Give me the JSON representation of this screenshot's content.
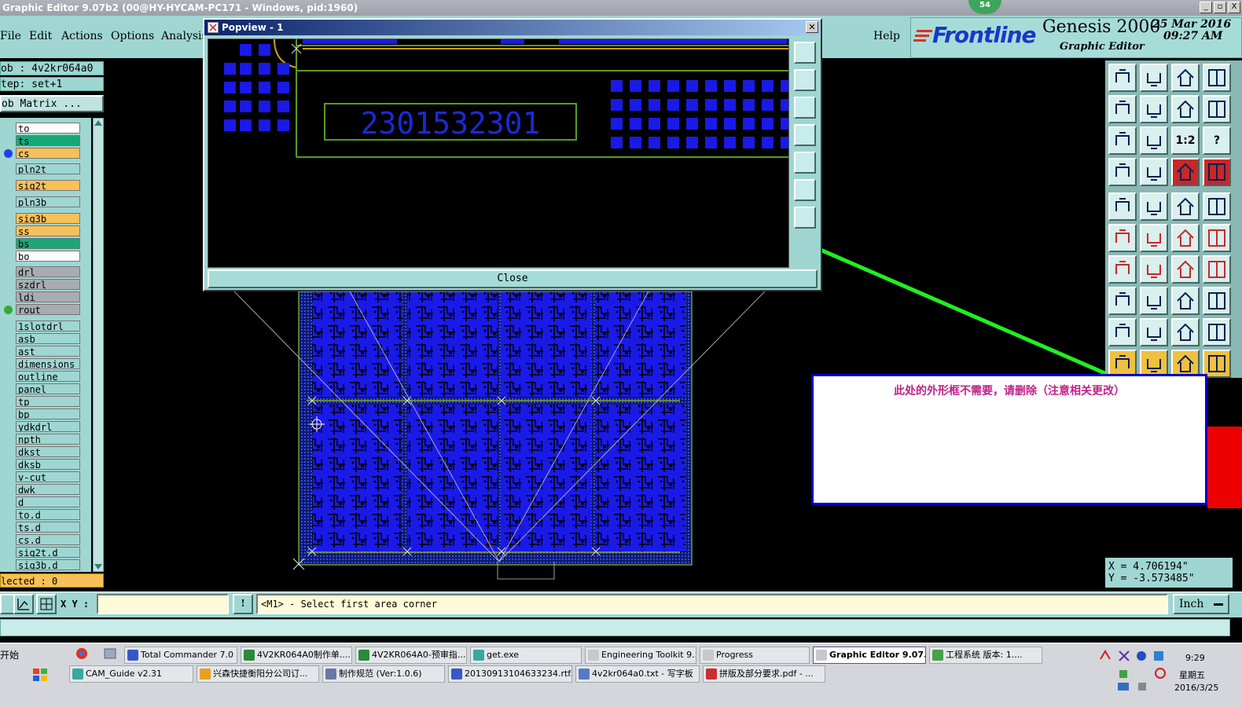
{
  "window": {
    "title": "Graphic Editor 9.07b2 (00@HY-HYCAM-PC171 - Windows, pid:1960)",
    "badge": "54",
    "min": "_",
    "max": "▫",
    "close": "X"
  },
  "menu": {
    "file": "File",
    "edit": "Edit",
    "actions": "Actions",
    "options": "Options",
    "analysis": "Analysis",
    "help": "Help"
  },
  "brand": {
    "frontline": "Frontline",
    "product": "Genesis 2000",
    "subtitle": "Graphic Editor",
    "date": "25 Mar 2016",
    "time": "09:27 AM"
  },
  "job": {
    "job_line": "ob : 4v2kr064a0",
    "step_line": "tep: set+1",
    "matrix_button": "ob Matrix ...",
    "selected": "lected : 0"
  },
  "layers": [
    {
      "name": "to",
      "bg": "#ffffff",
      "dot": ""
    },
    {
      "name": "ts",
      "bg": "#18a878",
      "dot": ""
    },
    {
      "name": "cs",
      "bg": "#f8c058",
      "dot": "#2040f0"
    },
    {
      "name": "pln2t",
      "bg": "#9fd6d2",
      "dot": ""
    },
    {
      "name": "sig2t",
      "bg": "#f8c058",
      "dot": ""
    },
    {
      "name": "pln3b",
      "bg": "#9fd6d2",
      "dot": ""
    },
    {
      "name": "sig3b",
      "bg": "#f8c058",
      "dot": ""
    },
    {
      "name": "ss",
      "bg": "#f8c058",
      "dot": ""
    },
    {
      "name": "bs",
      "bg": "#18a878",
      "dot": ""
    },
    {
      "name": "bo",
      "bg": "#ffffff",
      "dot": ""
    },
    {
      "name": "drl",
      "bg": "#a8acb0",
      "dot": ""
    },
    {
      "name": "szdrl",
      "bg": "#a8acb0",
      "dot": ""
    },
    {
      "name": "ldi",
      "bg": "#a8acb0",
      "dot": ""
    },
    {
      "name": "rout",
      "bg": "#a8acb0",
      "dot": "#38a838"
    },
    {
      "name": "1slotdrl",
      "bg": "#9fd6d2",
      "dot": ""
    },
    {
      "name": "asb",
      "bg": "#9fd6d2",
      "dot": ""
    },
    {
      "name": "ast",
      "bg": "#9fd6d2",
      "dot": ""
    },
    {
      "name": "dimensions",
      "bg": "#9fd6d2",
      "dot": ""
    },
    {
      "name": "outline",
      "bg": "#9fd6d2",
      "dot": ""
    },
    {
      "name": "panel",
      "bg": "#9fd6d2",
      "dot": ""
    },
    {
      "name": "tp",
      "bg": "#9fd6d2",
      "dot": ""
    },
    {
      "name": "bp",
      "bg": "#9fd6d2",
      "dot": ""
    },
    {
      "name": "ydkdrl",
      "bg": "#9fd6d2",
      "dot": ""
    },
    {
      "name": "npth",
      "bg": "#9fd6d2",
      "dot": ""
    },
    {
      "name": "dkst",
      "bg": "#9fd6d2",
      "dot": ""
    },
    {
      "name": "dksb",
      "bg": "#9fd6d2",
      "dot": ""
    },
    {
      "name": "v-cut",
      "bg": "#9fd6d2",
      "dot": ""
    },
    {
      "name": "dwk",
      "bg": "#9fd6d2",
      "dot": ""
    },
    {
      "name": "d",
      "bg": "#9fd6d2",
      "dot": ""
    },
    {
      "name": "to.d",
      "bg": "#9fd6d2",
      "dot": ""
    },
    {
      "name": "ts.d",
      "bg": "#9fd6d2",
      "dot": ""
    },
    {
      "name": "cs.d",
      "bg": "#9fd6d2",
      "dot": ""
    },
    {
      "name": "sig2t.d",
      "bg": "#9fd6d2",
      "dot": ""
    },
    {
      "name": "sig3b.d",
      "bg": "#9fd6d2",
      "dot": ""
    }
  ],
  "popview": {
    "title": "Popview - 1",
    "part_number": "2301532301",
    "close_label": "Close",
    "close_x": "✕"
  },
  "annotation": {
    "message": "此处的外形框不需要，请删除（注意相关更改）"
  },
  "tools": {
    "ratio_label": "1:2",
    "help_label": "?"
  },
  "coords": {
    "x": "X = 4.706194\"",
    "y": "Y = -3.573485\""
  },
  "command": {
    "xy_label": "X Y :",
    "xy_value": "",
    "prompt": "<M1> - Select first area corner",
    "unit": "Inch",
    "excl": "!"
  },
  "taskbar": {
    "start": "开始",
    "row1": [
      {
        "label": "Total Commander 7.0 ...",
        "color": "#3858c8"
      },
      {
        "label": "4V2KR064A0制作单....",
        "color": "#2a8a3a"
      },
      {
        "label": "4V2KR064A0-预审指...",
        "color": "#2a8a3a"
      },
      {
        "label": "get.exe",
        "color": "#38a8a0"
      },
      {
        "label": "Engineering Toolkit 9....",
        "color": "#c8c8c8"
      },
      {
        "label": "Progress",
        "color": "#c8c8c8"
      },
      {
        "label": "Graphic Editor 9.07...",
        "color": "#c8c8c8"
      },
      {
        "label": "工程系统  版本: 1....",
        "color": "#48a048"
      }
    ],
    "row2": [
      {
        "label": "CAM_Guide v2.31",
        "color": "#38a8a0"
      },
      {
        "label": "兴森快捷衡阳分公司订...",
        "color": "#e8a020"
      },
      {
        "label": "制作规范 (Ver:1.0.6)",
        "color": "#6878a8"
      },
      {
        "label": "20130913104633234.rtf...",
        "color": "#3858c8"
      },
      {
        "label": "4v2kr064a0.txt - 写字板",
        "color": "#5878c8"
      },
      {
        "label": "拼版及部分要求.pdf - ...",
        "color": "#c83030"
      }
    ],
    "clock_time": "9:29",
    "clock_day": "星期五",
    "clock_date": "2016/3/25"
  }
}
